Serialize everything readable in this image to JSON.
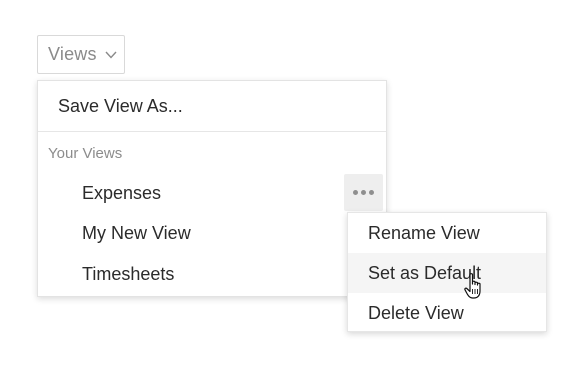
{
  "trigger": {
    "label": "Views",
    "icon": "chevron-down-icon"
  },
  "menu": {
    "save_view_label": "Save View As...",
    "section_label": "Your Views",
    "views": [
      {
        "label": "Expenses"
      },
      {
        "label": "My New View"
      },
      {
        "label": "Timesheets"
      }
    ],
    "more_icon": "more-horizontal-icon"
  },
  "submenu": {
    "items": [
      {
        "label": "Rename View"
      },
      {
        "label": "Set as Default",
        "hovered": true
      },
      {
        "label": "Delete View"
      }
    ]
  },
  "colors": {
    "text": "#2b2b2b",
    "muted": "#8c8c8c",
    "hover_bg": "#f5f5f5",
    "more_bg": "#eeeeee",
    "border": "#e3e3e3"
  }
}
